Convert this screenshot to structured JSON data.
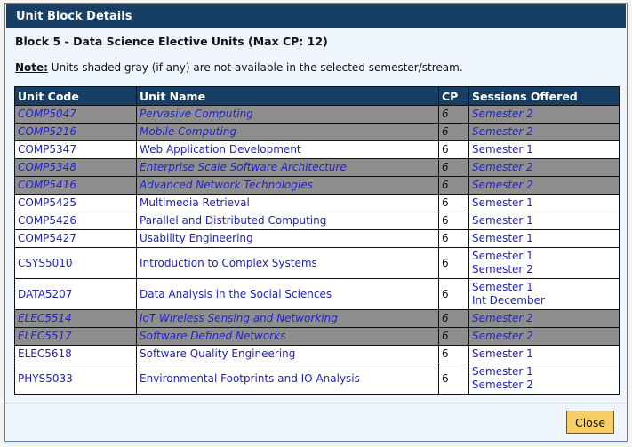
{
  "dialog": {
    "title": "Unit Block Details",
    "block_title": "Block 5 - Data Science Elective Units (Max CP: 12)",
    "note_label": "Note:",
    "note_text": " Units shaded gray (if any) are not available in the selected semester/stream.",
    "close_label": "Close"
  },
  "table": {
    "headers": [
      "Unit Code",
      "Unit Name",
      "CP",
      "Sessions Offered"
    ],
    "rows": [
      {
        "code": "COMP5047",
        "name": "Pervasive Computing",
        "cp": "6",
        "sessions": [
          "Semester 2"
        ],
        "unavailable": true
      },
      {
        "code": "COMP5216",
        "name": "Mobile Computing",
        "cp": "6",
        "sessions": [
          "Semester 2"
        ],
        "unavailable": true
      },
      {
        "code": "COMP5347",
        "name": "Web Application Development",
        "cp": "6",
        "sessions": [
          "Semester 1"
        ],
        "unavailable": false
      },
      {
        "code": "COMP5348",
        "name": "Enterprise Scale Software Architecture",
        "cp": "6",
        "sessions": [
          "Semester 2"
        ],
        "unavailable": true
      },
      {
        "code": "COMP5416",
        "name": "Advanced Network Technologies",
        "cp": "6",
        "sessions": [
          "Semester 2"
        ],
        "unavailable": true
      },
      {
        "code": "COMP5425",
        "name": "Multimedia Retrieval",
        "cp": "6",
        "sessions": [
          "Semester 1"
        ],
        "unavailable": false
      },
      {
        "code": "COMP5426",
        "name": "Parallel and Distributed Computing",
        "cp": "6",
        "sessions": [
          "Semester 1"
        ],
        "unavailable": false
      },
      {
        "code": "COMP5427",
        "name": "Usability Engineering",
        "cp": "6",
        "sessions": [
          "Semester 1"
        ],
        "unavailable": false
      },
      {
        "code": "CSYS5010",
        "name": "Introduction to Complex Systems",
        "cp": "6",
        "sessions": [
          "Semester 1",
          "Semester 2"
        ],
        "unavailable": false
      },
      {
        "code": "DATA5207",
        "name": "Data Analysis in the Social Sciences",
        "cp": "6",
        "sessions": [
          "Semester 1",
          "Int December"
        ],
        "unavailable": false
      },
      {
        "code": "ELEC5514",
        "name": "IoT Wireless Sensing and Networking",
        "cp": "6",
        "sessions": [
          "Semester 2"
        ],
        "unavailable": true
      },
      {
        "code": "ELEC5517",
        "name": "Software Defined Networks",
        "cp": "6",
        "sessions": [
          "Semester 2"
        ],
        "unavailable": true
      },
      {
        "code": "ELEC5618",
        "name": "Software Quality Engineering",
        "cp": "6",
        "sessions": [
          "Semester 1"
        ],
        "unavailable": false
      },
      {
        "code": "PHYS5033",
        "name": "Environmental Footprints and IO Analysis",
        "cp": "6",
        "sessions": [
          "Semester 1",
          "Semester 2"
        ],
        "unavailable": false
      }
    ]
  }
}
